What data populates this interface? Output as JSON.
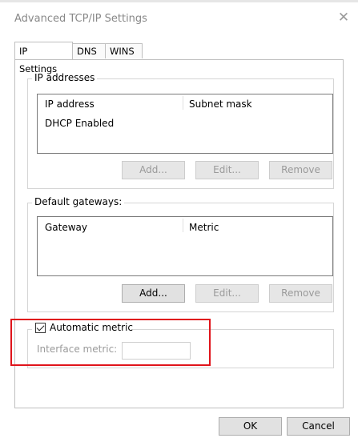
{
  "window": {
    "title": "Advanced TCP/IP Settings",
    "close_glyph": "✕"
  },
  "tabs": [
    {
      "label": "IP Settings",
      "active": true
    },
    {
      "label": "DNS",
      "active": false
    },
    {
      "label": "WINS",
      "active": false
    }
  ],
  "ip_addresses": {
    "group_label": "IP addresses",
    "columns": [
      "IP address",
      "Subnet mask"
    ],
    "rows": [
      [
        "DHCP Enabled",
        ""
      ]
    ],
    "buttons": {
      "add": "Add...",
      "edit": "Edit...",
      "remove": "Remove"
    }
  },
  "default_gateways": {
    "group_label": "Default gateways:",
    "columns": [
      "Gateway",
      "Metric"
    ],
    "rows": [],
    "buttons": {
      "add": "Add...",
      "edit": "Edit...",
      "remove": "Remove"
    }
  },
  "metric": {
    "automatic_metric_label": "Automatic metric",
    "automatic_metric_checked": true,
    "interface_metric_label": "Interface metric:",
    "interface_metric_value": ""
  },
  "footer": {
    "ok": "OK",
    "cancel": "Cancel"
  },
  "colors": {
    "highlight": "#e0141b"
  }
}
